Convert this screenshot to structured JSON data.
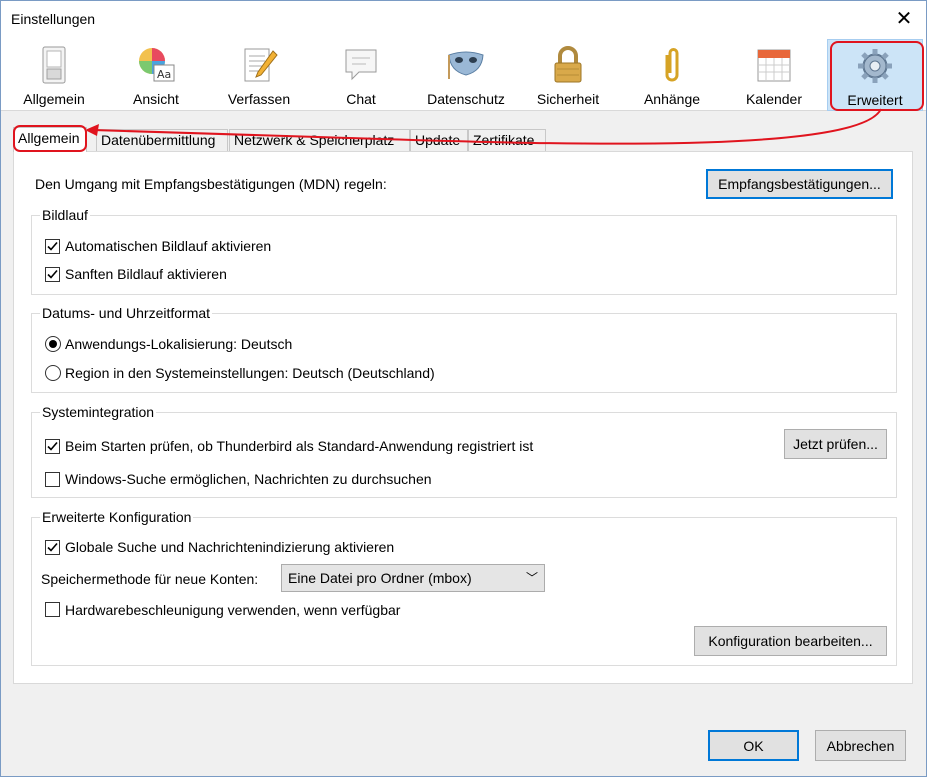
{
  "window": {
    "title": "Einstellungen"
  },
  "toolbar": {
    "items": [
      {
        "label": "Allgemein",
        "icon": "switch-icon"
      },
      {
        "label": "Ansicht",
        "icon": "palette-icon"
      },
      {
        "label": "Verfassen",
        "icon": "compose-icon"
      },
      {
        "label": "Chat",
        "icon": "chat-icon"
      },
      {
        "label": "Datenschutz",
        "icon": "mask-icon"
      },
      {
        "label": "Sicherheit",
        "icon": "lock-icon"
      },
      {
        "label": "Anhänge",
        "icon": "paperclip-icon"
      },
      {
        "label": "Kalender",
        "icon": "calendar-icon"
      },
      {
        "label": "Erweitert",
        "icon": "gear-icon"
      }
    ],
    "selected": "Erweitert"
  },
  "subtabs": [
    "Allgemein",
    "Datenübermittlung",
    "Netzwerk & Speicherplatz",
    "Update",
    "Zertifikate"
  ],
  "mdn": {
    "label": "Den Umgang mit Empfangsbestätigungen (MDN) regeln:",
    "button": "Empfangsbestätigungen..."
  },
  "bildlauf": {
    "title": "Bildlauf",
    "auto_scroll": "Automatischen Bildlauf aktivieren",
    "smooth_scroll": "Sanften Bildlauf aktivieren"
  },
  "datetime": {
    "title": "Datums- und Uhrzeitformat",
    "option_app": "Anwendungs-Lokalisierung: Deutsch",
    "option_region": "Region in den Systemeinstellungen: Deutsch (Deutschland)"
  },
  "system": {
    "title": "Systemintegration",
    "check_default": "Beim Starten prüfen, ob Thunderbird als Standard-Anwendung registriert ist",
    "check_now_button": "Jetzt prüfen...",
    "windows_search": "Windows-Suche ermöglichen, Nachrichten zu durchsuchen"
  },
  "advanced": {
    "title": "Erweiterte Konfiguration",
    "global_search": "Globale Suche und Nachrichtenindizierung aktivieren",
    "storage_label": "Speichermethode für neue Konten:",
    "storage_value": "Eine Datei pro Ordner (mbox)",
    "hw_accel": "Hardwarebeschleunigung verwenden, wenn verfügbar",
    "config_button": "Konfiguration bearbeiten..."
  },
  "footer": {
    "ok": "OK",
    "cancel": "Abbrechen"
  },
  "colors": {
    "accent": "#0078d7",
    "annotation": "#e0141e",
    "selected_bg": "#cce4f7"
  }
}
